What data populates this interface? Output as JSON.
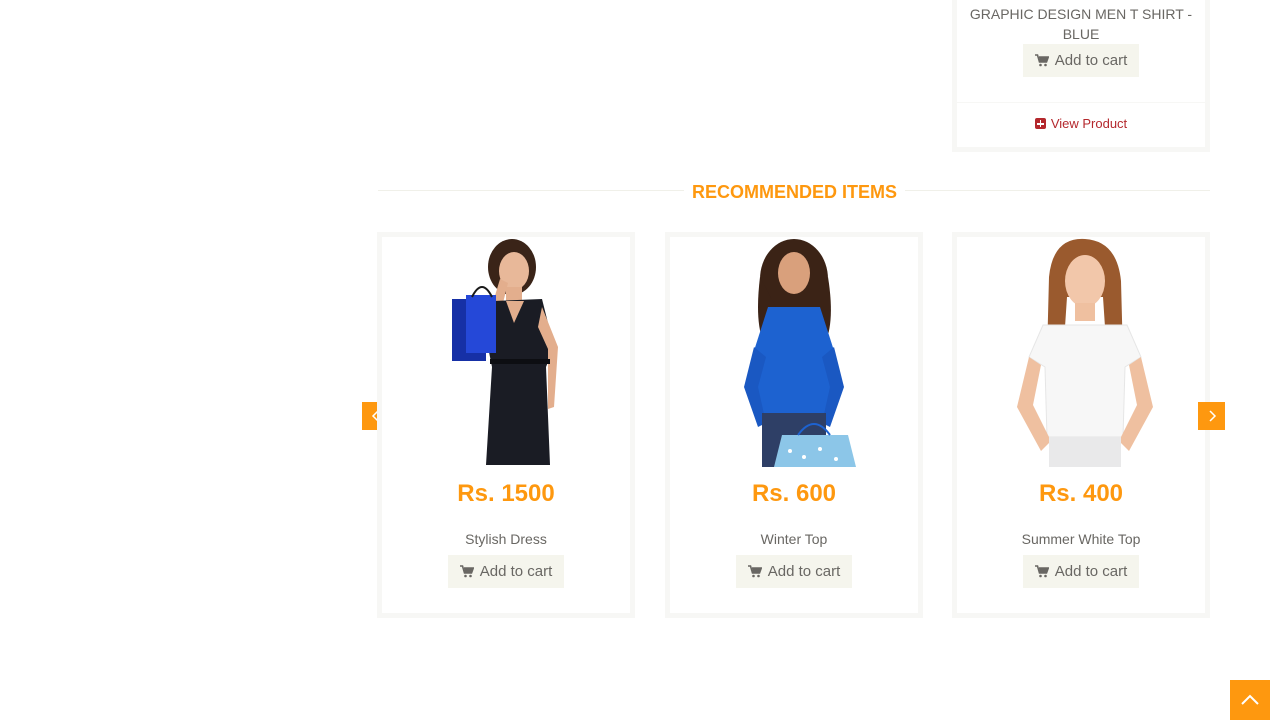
{
  "top_product": {
    "name": "GRAPHIC DESIGN MEN T SHIRT - BLUE",
    "add_to_cart": "Add to cart",
    "view_product": "View Product"
  },
  "recommended": {
    "title": "RECOMMENDED ITEMS",
    "items": [
      {
        "price": "Rs. 1500",
        "name": "Stylish Dress",
        "add_to_cart": "Add to cart",
        "image": "woman-black-dress-shopping-bag"
      },
      {
        "price": "Rs. 600",
        "name": "Winter Top",
        "add_to_cart": "Add to cart",
        "image": "woman-blue-top-shopping-bag"
      },
      {
        "price": "Rs. 400",
        "name": "Summer White Top",
        "add_to_cart": "Add to cart",
        "image": "woman-white-top"
      }
    ]
  },
  "controls": {
    "prev_icon": "chevron-left-icon",
    "next_icon": "chevron-right-icon",
    "scroll_up_icon": "chevron-up-icon"
  },
  "colors": {
    "accent": "#fe980f",
    "link": "#b4282d",
    "text": "#696763",
    "button_bg": "#f5f5ed"
  }
}
